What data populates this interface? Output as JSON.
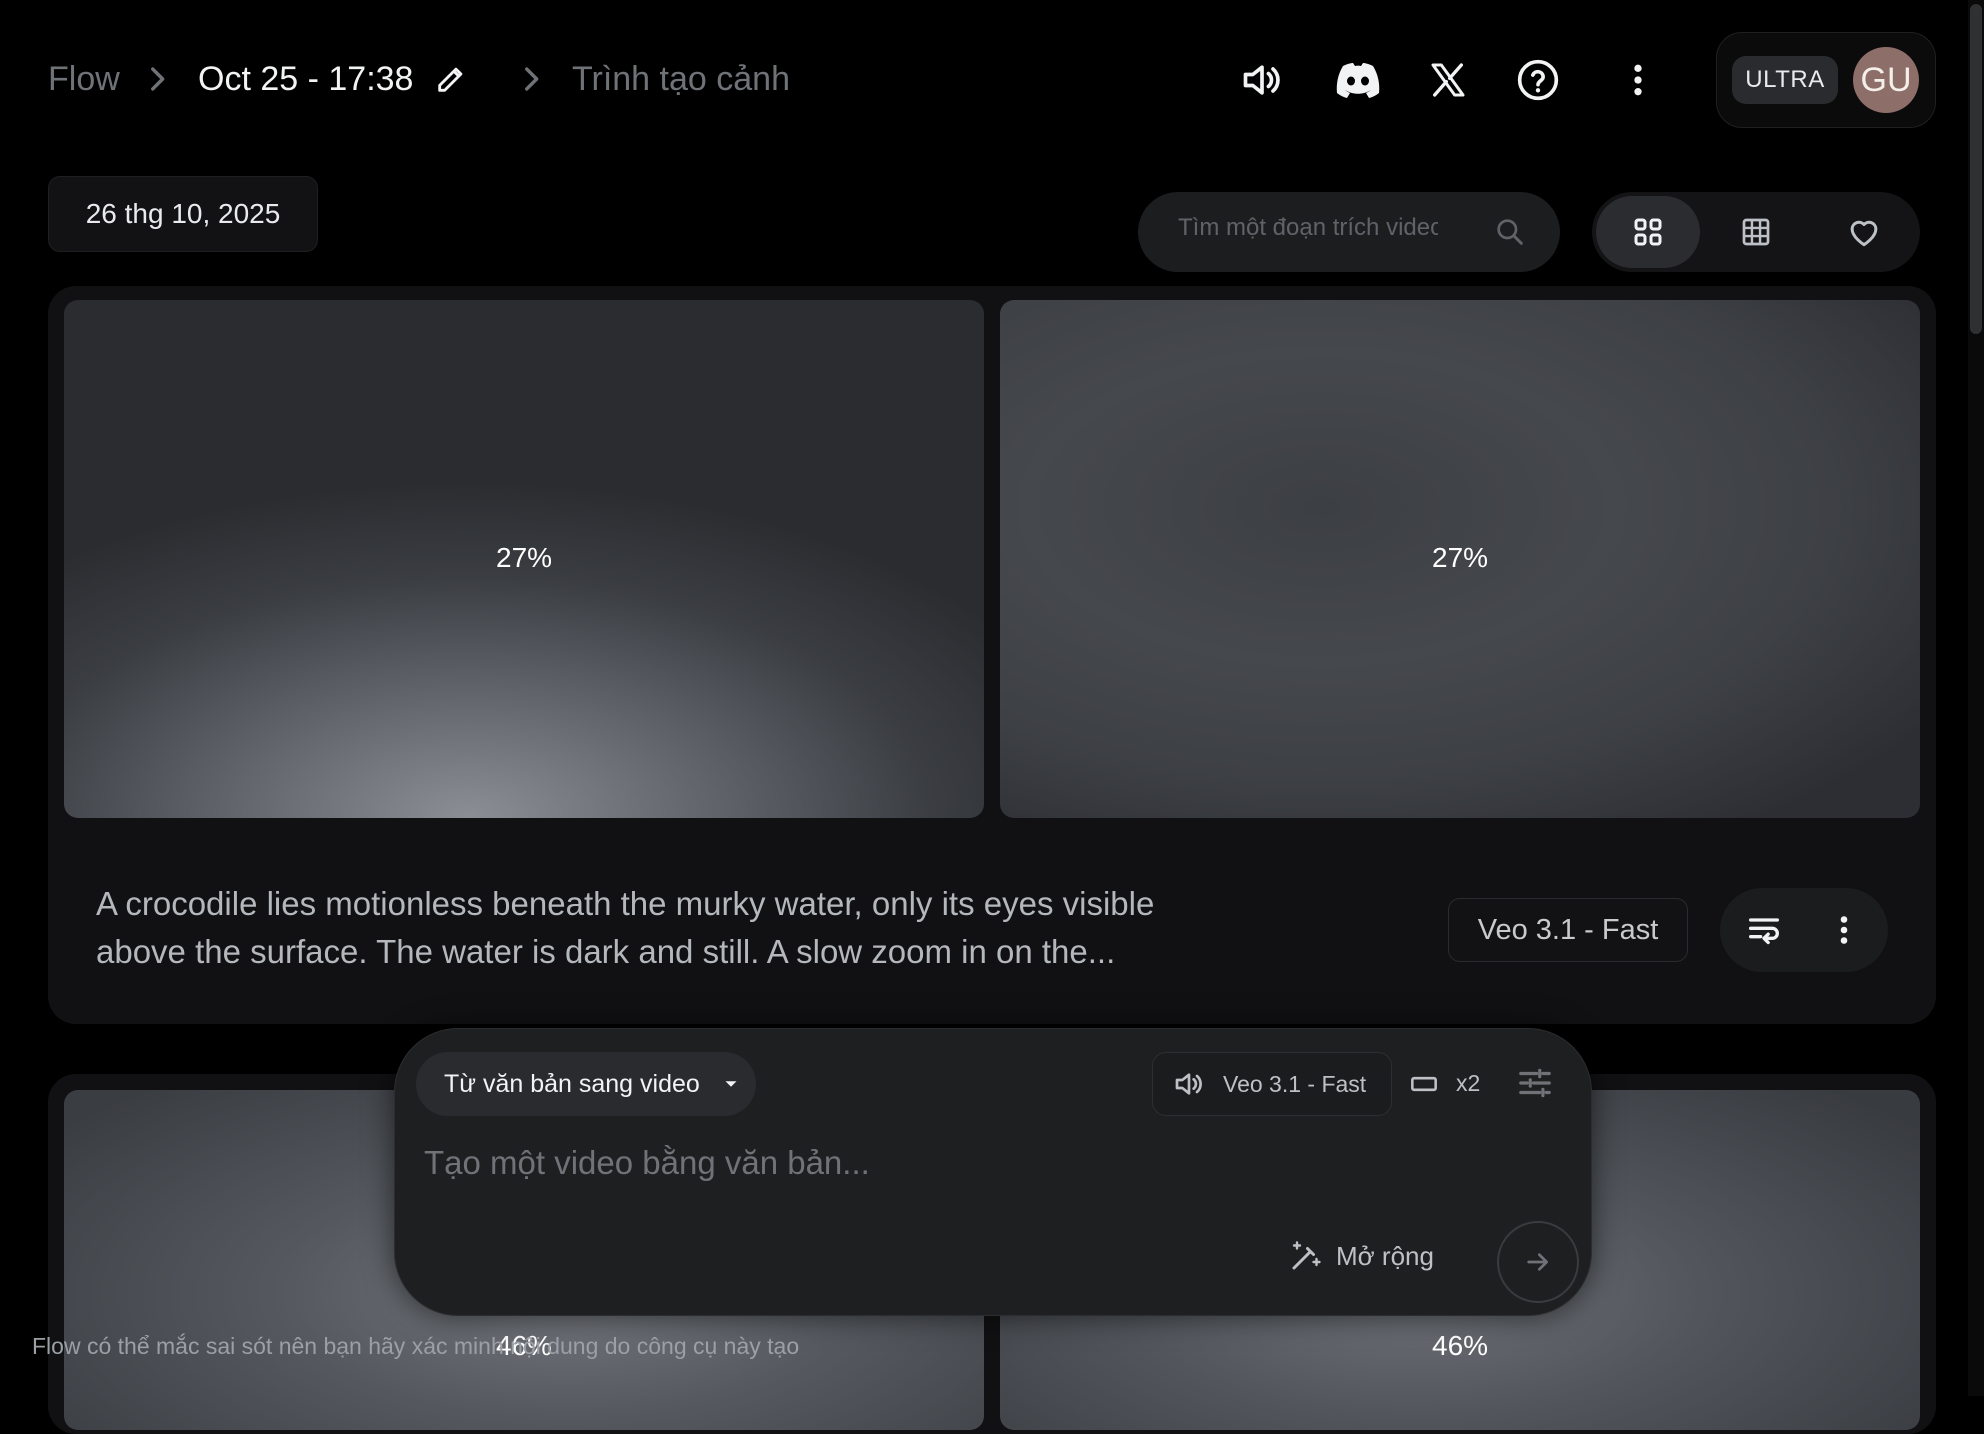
{
  "header": {
    "breadcrumb_root": "Flow",
    "project_title": "Oct 25 - 17:38",
    "breadcrumb_current": "Trình tạo cảnh",
    "plan_badge": "ULTRA",
    "avatar_initials": "GU"
  },
  "toolbar": {
    "date": "26 thg 10, 2025",
    "search_placeholder": "Tìm một đoạn trích video"
  },
  "clips_group_1": {
    "progress": [
      "27%",
      "27%"
    ],
    "prompt": "A crocodile lies motionless beneath the murky water, only its eyes visible above the surface. The water is dark and still. A slow zoom in on the...",
    "model": "Veo 3.1 - Fast"
  },
  "clips_group_2": {
    "progress": [
      "46%",
      "46%"
    ]
  },
  "composer": {
    "mode": "Từ văn bản sang video",
    "model": "Veo 3.1 - Fast",
    "count": "x2",
    "placeholder": "Tạo một video bằng văn bản...",
    "expand_label": "Mở rộng"
  },
  "footer": {
    "disclaimer": "Flow có thể mắc sai sót nên bạn hãy xác minh nội dung do công cụ này tạo"
  },
  "icons": {
    "edit": "pencil-icon",
    "sound": "speaker-icon",
    "discord": "discord-icon",
    "x": "x-logo-icon",
    "help": "help-icon",
    "more": "more-vert-icon",
    "search": "search-icon",
    "grid_large": "grid-large-icon",
    "grid_small": "grid-small-icon",
    "favorite": "heart-icon",
    "reuse_prompt": "wrap-text-icon",
    "aspect": "aspect-landscape-icon",
    "tune": "tune-icon",
    "magic": "magic-pen-icon",
    "send": "arrow-right-icon"
  }
}
